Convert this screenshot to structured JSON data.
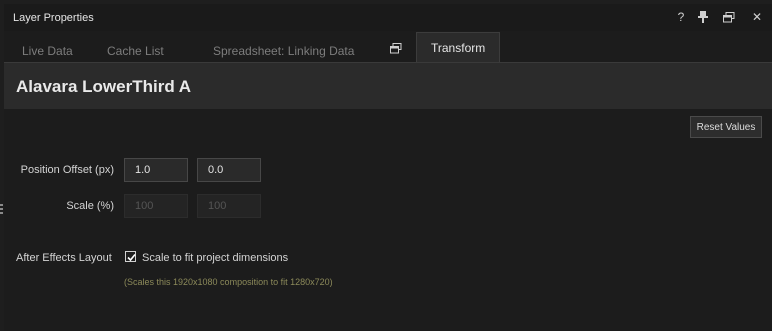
{
  "window": {
    "title": "Layer Properties",
    "controls": [
      "help",
      "pin",
      "restore",
      "close"
    ],
    "control_glyphs": {
      "help": "?",
      "close": "✕"
    }
  },
  "tabs": [
    {
      "label": "Live Data",
      "active": false
    },
    {
      "label": "Cache List",
      "active": false
    },
    {
      "label": "Spreadsheet: Linking Data",
      "active": false
    },
    {
      "label": "Transform",
      "active": true
    }
  ],
  "tab_icon": "window-restore-icon",
  "layer": {
    "name": "Alavara LowerThird A"
  },
  "toolbar": {
    "reset_label": "Reset Values"
  },
  "transform": {
    "position_offset": {
      "label": "Position Offset (px)",
      "x": "1.0",
      "y": "0.0"
    },
    "scale": {
      "label": "Scale (%)",
      "x": "100",
      "y": "100",
      "disabled": true
    }
  },
  "ae_layout": {
    "label": "After Effects Layout",
    "checkbox_label": "Scale to fit project dimensions",
    "checked": true,
    "hint": "(Scales this 1920x1080 composition to fit 1280x720)"
  },
  "colors": {
    "background": "#1c1c1c",
    "header": "#2b2b2b",
    "hint": "#8c8a5a",
    "text": "#d4d4d4"
  }
}
